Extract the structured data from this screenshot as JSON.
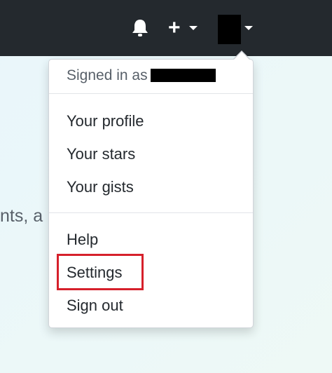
{
  "header": {
    "notifications_icon": "bell-icon",
    "create_icon": "plus-icon",
    "dropdown_icon": "caret-down-icon"
  },
  "background": {
    "partial_text": "nts, a"
  },
  "user_menu": {
    "signed_in_label": "Signed in as",
    "items": [
      {
        "label": "Your profile"
      },
      {
        "label": "Your stars"
      },
      {
        "label": "Your gists"
      },
      {
        "label": "Help"
      },
      {
        "label": "Settings"
      },
      {
        "label": "Sign out"
      }
    ],
    "highlighted_item": "Settings",
    "highlight_color": "#d6202b"
  },
  "colors": {
    "header_bg": "#24292e",
    "menu_text": "#24292e",
    "muted_text": "#586069"
  }
}
